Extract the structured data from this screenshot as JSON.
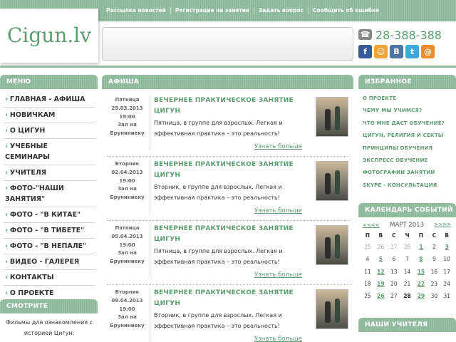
{
  "top_nav": [
    "Рассылка новостей",
    "Регистрация на занятия",
    "Задать вопрос",
    "Сообщить об ошибке"
  ],
  "logo": "Cigun.lv",
  "phone": "28-388-388",
  "social": [
    "facebook-icon",
    "odnoklassniki-icon",
    "vkontakte-icon",
    "twitter-icon",
    "mailru-icon"
  ],
  "colors": {
    "accent": "#5b9d70",
    "header": "#8ab898"
  },
  "menu": {
    "title": "МЕНЮ",
    "items": [
      "ГЛАВНАЯ - АФИША",
      "НОВИЧКАМ",
      "О ЦИГУН",
      "УЧЕБНЫЕ СЕМИНАРЫ",
      "УЧИТЕЛЯ",
      "ФОТО-\"НАШИ ЗАНЯТИЯ\"",
      "ФОТО - \"В КИТАЕ\"",
      "ФОТО - \"В ТИБЕТЕ\"",
      "ФОТО - \"В НЕПАЛЕ\"",
      "ВИДЕО - ГАЛЕРЕЯ",
      "КОНТАКТЫ",
      "О ПРОЕКТЕ"
    ]
  },
  "watch": {
    "title": "СМОТРИТЕ",
    "text": "Фильмы для ознакомления с историей Цигун:"
  },
  "afisha": {
    "title": "АФИША",
    "events": [
      {
        "day": "Пятница",
        "date": "29.03.2013",
        "time": "19:00",
        "place1": "Зал на",
        "place2": "Бруниниеку",
        "title": "ВЕЧЕРНЕЕ ПРАКТИЧЕСКОЕ ЗАНЯТИЕ ЦИГУН",
        "text": "Пятница, в группе для взрослых. Легкая и эффективная практика – это реальность!",
        "more": "Узнать больше"
      },
      {
        "day": "Вторник",
        "date": "02.04.2013",
        "time": "19:00",
        "place1": "Зал на",
        "place2": "Бруниниеку",
        "title": "ВЕЧЕРНЕЕ ПРАКТИЧЕСКОЕ ЗАНЯТИЕ ЦИГУН",
        "text": "Вторник, в группе для взрослых. Легкая и эффективная практика – это реальность!",
        "more": "Узнать больше"
      },
      {
        "day": "Пятница",
        "date": "05.04.2013",
        "time": "19:00",
        "place1": "Зал на",
        "place2": "Бруниниеку",
        "title": "ВЕЧЕРНЕЕ ПРАКТИЧЕСКОЕ ЗАНЯТИЕ ЦИГУН",
        "text": "Пятница, в группе для взрослых. Легкая и эффективная практика – это реальность!",
        "more": "Узнать больше"
      },
      {
        "day": "Вторник",
        "date": "09.04.2013",
        "time": "19:00",
        "place1": "Зал на",
        "place2": "Бруниниеку",
        "title": "ВЕЧЕРНЕЕ ПРАКТИЧЕСКОЕ ЗАНЯТИЕ ЦИГУН",
        "text": "Вторник, в группе для взрослых. Легкая и эффективная практика – это реальность!",
        "more": "Узнать больше"
      }
    ]
  },
  "favorites": {
    "title": "ИЗБРАННОЕ",
    "items": [
      "О ПРОЕКТЕ",
      "ЧЕМУ МЫ УЧИМСЯ?",
      "ЧТО МНЕ ДАСТ ОБУЧЕНИЕ?",
      "ЦИГУН, РЕЛИГИЯ И СЕКТЫ",
      "ПРИНЦИПЫ ОБУЧЕНИЯ",
      "ЭКСПРЕСС ОБУЧЕНИЕ",
      "ФОТОГРАФИИ ЗАНЯТИЙ",
      "SKYPE - КОНСУЛЬТАЦИЯ"
    ]
  },
  "calendar": {
    "title": "КАЛЕНДАРЬ СОБЫТИЙ",
    "prev": "<<<<",
    "month": "МАРТ 2013",
    "next": ">>>>",
    "weekdays": [
      "П",
      "В",
      "С",
      "Ч",
      "П",
      "С",
      "В"
    ],
    "weeks": [
      [
        "25",
        "26",
        "27",
        "28",
        "1",
        "2",
        "3"
      ],
      [
        "4",
        "5",
        "6",
        "7",
        "8",
        "9",
        "10"
      ],
      [
        "11",
        "12",
        "13",
        "14",
        "15",
        "16",
        "17"
      ],
      [
        "18",
        "19",
        "20",
        "21",
        "22",
        "23",
        "24"
      ],
      [
        "25",
        "26",
        "27",
        "28",
        "29",
        "30",
        "31"
      ]
    ],
    "other_month": [
      "0-0",
      "0-1",
      "0-2",
      "0-3"
    ],
    "linked": [
      "0-4",
      "0-6",
      "1-1",
      "1-4",
      "2-1",
      "2-4",
      "3-1",
      "3-4",
      "4-1",
      "4-4"
    ],
    "today": "4-3"
  },
  "teachers": {
    "title": "НАШИ УЧИТЕЛЯ"
  }
}
